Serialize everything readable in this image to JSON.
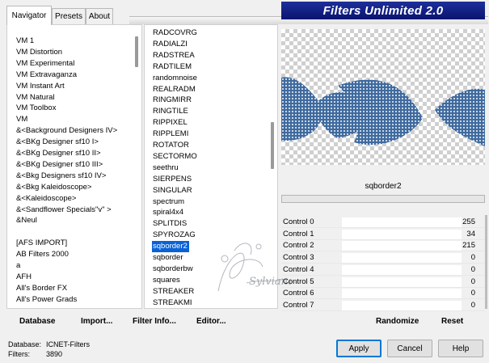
{
  "tabs": [
    {
      "label": "Navigator",
      "active": true
    },
    {
      "label": "Presets",
      "active": false
    },
    {
      "label": "About",
      "active": false
    }
  ],
  "banner_title": "Filters Unlimited 2.0",
  "categories": [
    "VM 1",
    "VM Distortion",
    "VM Experimental",
    "VM Extravaganza",
    "VM Instant Art",
    "VM Natural",
    "VM Toolbox",
    "VM",
    "&<Background Designers IV>",
    "&<BKg Designer sf10 I>",
    "&<BKg Designer sf10 II>",
    "&<BKg Designer sf10 III>",
    "&<Bkg Designers sf10 IV>",
    "&<Bkg Kaleidoscope>",
    "&<Kaleidoscope>",
    "&<Sandflower Specials\"v\" >",
    "&Neul",
    "",
    "[AFS IMPORT]",
    "AB Filters 2000",
    "a",
    "AFH",
    "All's Border FX",
    "All's Power Grads"
  ],
  "filters": [
    "RADCOVRG",
    "RADIALZI",
    "RADSTREA",
    "RADTILEM",
    "randomnoise",
    "REALRADM",
    "RINGMIRR",
    "RINGTILE",
    "RIPPIXEL",
    "RIPPLEMI",
    "ROTATOR",
    "SECTORMO",
    "seethru",
    "SIERPENS",
    "SINGULAR",
    "spectrum",
    "spiral4x4",
    "SPLITDIS",
    "SPYROZAG",
    "sqborder2",
    "sqborder",
    "sqborderbw",
    "squares",
    "STREAKER",
    "STREAKMI"
  ],
  "selected_filter_index": 19,
  "selected_filter_name": "sqborder2",
  "controls": [
    {
      "label": "Control 0",
      "value": "255"
    },
    {
      "label": "Control 1",
      "value": "34"
    },
    {
      "label": "Control 2",
      "value": "215"
    },
    {
      "label": "Control 3",
      "value": "0"
    },
    {
      "label": "Control 4",
      "value": "0"
    },
    {
      "label": "Control 5",
      "value": "0"
    },
    {
      "label": "Control 6",
      "value": "0"
    },
    {
      "label": "Control 7",
      "value": "0"
    }
  ],
  "actions": {
    "database": "Database",
    "import": "Import...",
    "filter_info": "Filter Info...",
    "editor": "Editor...",
    "randomize": "Randomize",
    "reset": "Reset"
  },
  "footer": {
    "database_label": "Database:",
    "database_value": "ICNET-Filters",
    "filters_label": "Filters:",
    "filters_value": "3890"
  },
  "buttons": {
    "apply": "Apply",
    "cancel": "Cancel",
    "help": "Help"
  },
  "colors": {
    "banner": "#0a1470",
    "selection": "#0a62d6",
    "preview_pattern": "#4f77a8"
  }
}
